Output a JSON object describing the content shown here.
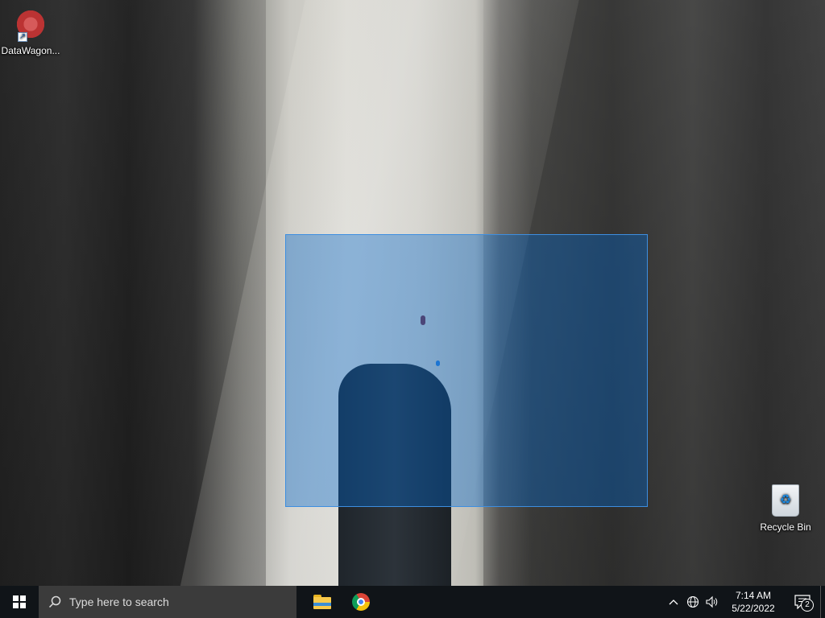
{
  "desktop": {
    "icons": [
      {
        "label": "DataWagon...",
        "icon": "datawagon-logo"
      },
      {
        "label": "Recycle Bin",
        "icon": "recycle-bin-icon"
      }
    ]
  },
  "taskbar": {
    "search_placeholder": "Type here to search",
    "pinned_apps": [
      "file-explorer",
      "google-chrome"
    ],
    "clock": {
      "time": "7:14 AM",
      "date": "5/22/2022"
    },
    "notification_count": "2"
  },
  "colors": {
    "taskbar_bg": "#101418",
    "selection_fill": "#0066cc",
    "selection_border": "#3d8ee0"
  }
}
